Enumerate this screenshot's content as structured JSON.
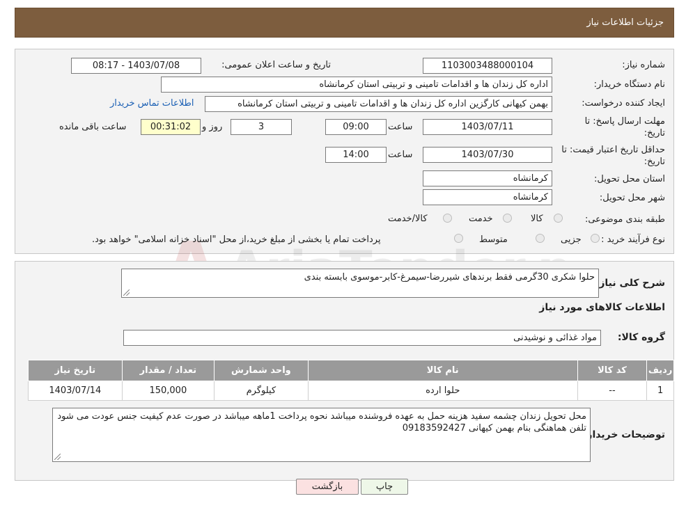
{
  "header": {
    "title": "جزئیات اطلاعات نیاز"
  },
  "watermark": {
    "text": "AriaTender.neT"
  },
  "form": {
    "need_number_label": "شماره نیاز:",
    "need_number": "1103003488000104",
    "announce_label": "تاریخ و ساعت اعلان عمومی:",
    "announce_value": "1403/07/08 - 08:17",
    "buyer_org_label": "نام دستگاه خریدار:",
    "buyer_org": "اداره کل زندان ها و اقدامات تامینی و تربیتی استان کرمانشاه",
    "requester_label": "ایجاد کننده درخواست:",
    "requester": "بهمن کیهانی کارگزین اداره کل زندان ها و اقدامات تامینی و تربیتی استان کرمانشاه",
    "contact_link": "اطلاعات تماس خریدار",
    "deadline_label_1": "مهلت ارسال پاسخ: تا",
    "deadline_label_2": "تاریخ:",
    "deadline_date": "1403/07/11",
    "time_label": "ساعت",
    "deadline_time": "09:00",
    "days_value": "3",
    "days_label": "روز و",
    "remaining_time": "00:31:02",
    "remaining_label": "ساعت باقی مانده",
    "validity_label_1": "حداقل تاریخ اعتبار قیمت: تا",
    "validity_label_2": "تاریخ:",
    "validity_date": "1403/07/30",
    "validity_time": "14:00",
    "province_label": "استان محل تحویل:",
    "province": "کرمانشاه",
    "city_label": "شهر محل تحویل:",
    "city": "کرمانشاه",
    "category_label": "طبقه بندی موضوعی:",
    "category_options": [
      "کالا",
      "خدمت",
      "کالا/خدمت"
    ],
    "process_label": "نوع فرآیند خرید :",
    "process_options": [
      "جزیی",
      "متوسط"
    ],
    "process_note": "پرداخت تمام یا بخشی از مبلغ خرید،از محل \"اسناد خزانه اسلامی\" خواهد بود."
  },
  "details": {
    "summary_label": "شرح کلی نیاز:",
    "summary": "حلوا شکری 30گرمی فقط برندهای شیررضا-سیمرغ-کابر-موسوی بابسته بندی",
    "goods_info_title": "اطلاعات کالاهای مورد نیاز",
    "goods_group_label": "گروه کالا:",
    "goods_group": "مواد غذائی و نوشیدنی",
    "table": {
      "headers": [
        "ردیف",
        "کد کالا",
        "نام کالا",
        "واحد شمارش",
        "تعداد / مقدار",
        "تاریخ نیاز"
      ],
      "rows": [
        [
          "1",
          "--",
          "حلوا ارده",
          "کیلوگرم",
          "150,000",
          "1403/07/14"
        ]
      ]
    },
    "buyer_notes_label": "توضیحات خریدار:",
    "buyer_notes": "محل تحویل زندان چشمه سفید هزینه حمل به عهده فروشنده میباشد نحوه پرداخت 1ماهه میباشد در صورت عدم کیفیت جنس عودت می شود تلفن هماهنگی بنام بهمن کیهانی  09183592427"
  },
  "buttons": {
    "print": "چاپ",
    "back": "بازگشت"
  },
  "colors": {
    "header": "#7d5d3e",
    "table_header": "#9a9a9a",
    "link": "#1a5fb4"
  }
}
